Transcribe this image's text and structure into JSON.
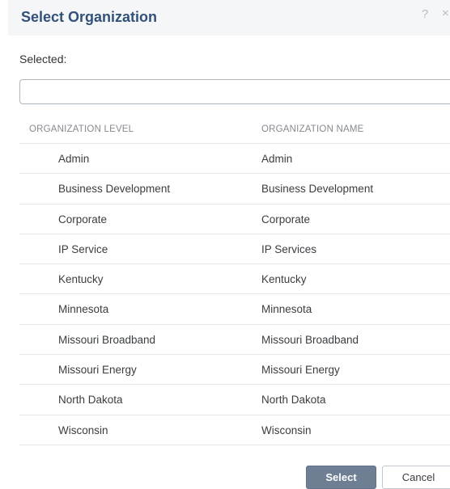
{
  "dialog": {
    "title": "Select Organization",
    "help_icon": "?",
    "close_icon": "×"
  },
  "selected": {
    "label": "Selected:",
    "value": ""
  },
  "table": {
    "columns": [
      "ORGANIZATION LEVEL",
      "ORGANIZATION NAME"
    ],
    "rows": [
      {
        "level": "Admin",
        "name": "Admin"
      },
      {
        "level": "Business Development",
        "name": "Business Development"
      },
      {
        "level": "Corporate",
        "name": "Corporate"
      },
      {
        "level": "IP Service",
        "name": "IP Services"
      },
      {
        "level": "Kentucky",
        "name": "Kentucky"
      },
      {
        "level": "Minnesota",
        "name": "Minnesota"
      },
      {
        "level": "Missouri Broadband",
        "name": "Missouri Broadband"
      },
      {
        "level": "Missouri Energy",
        "name": "Missouri Energy"
      },
      {
        "level": "North Dakota",
        "name": "North Dakota"
      },
      {
        "level": "Wisconsin",
        "name": "Wisconsin"
      }
    ]
  },
  "footer": {
    "select_label": "Select",
    "cancel_label": "Cancel"
  },
  "colors": {
    "title": "#31507a",
    "primary_button": "#6e7f94",
    "row_divider": "#e3e6ea"
  }
}
